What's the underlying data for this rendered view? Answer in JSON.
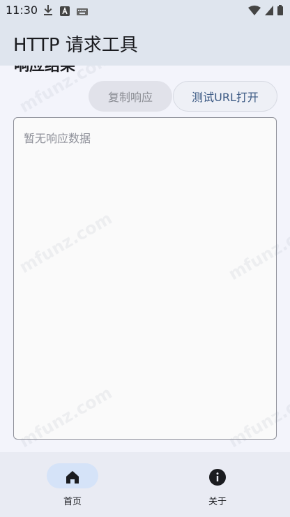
{
  "status_bar": {
    "time": "11:30",
    "left_icons": [
      "download-icon",
      "a-box-icon",
      "keyboard-icon"
    ],
    "right_icons": [
      "wifi-icon",
      "signal-icon",
      "battery-icon"
    ]
  },
  "app_bar": {
    "title": "HTTP 请求工具"
  },
  "section": {
    "heading": "响应结果"
  },
  "actions": {
    "copy_label": "复制响应",
    "test_label": "测试URL打开"
  },
  "response": {
    "placeholder": "暂无响应数据"
  },
  "watermark": {
    "text": "mfunz.com"
  },
  "bottom_nav": {
    "items": [
      {
        "label": "首页",
        "icon": "home-icon",
        "selected": true
      },
      {
        "label": "关于",
        "icon": "info-icon",
        "selected": false
      }
    ]
  },
  "colors": {
    "app_bar": "#dfe5ee",
    "background": "#f3f4fb",
    "accent": "#3c5a84",
    "nav_pill": "#d5e3f8"
  }
}
